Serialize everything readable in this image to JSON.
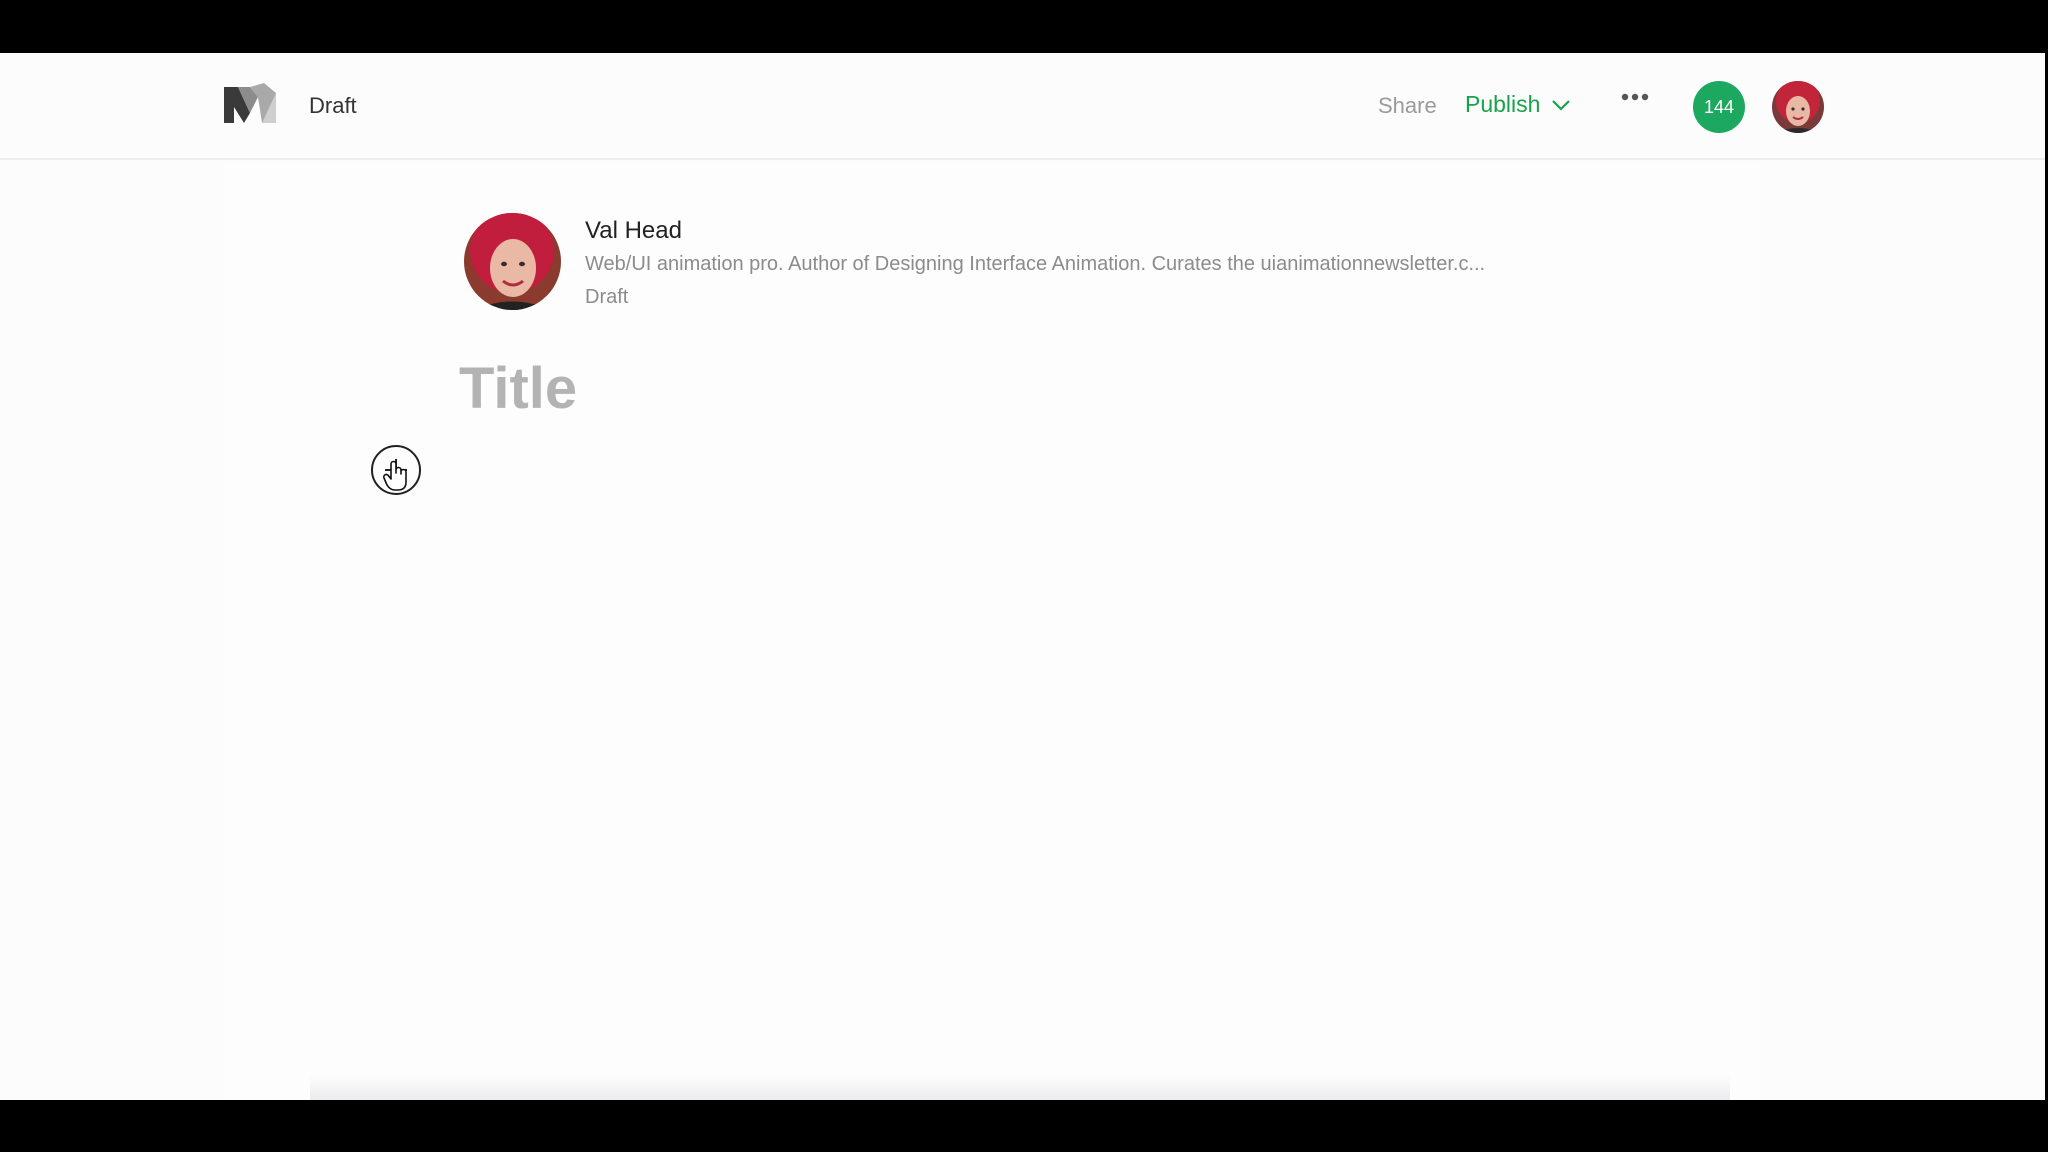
{
  "header": {
    "logo": "medium-logo-icon",
    "status": "Draft",
    "share_label": "Share",
    "publish_label": "Publish",
    "more_icon": "ellipsis-icon",
    "notifications_count": "144"
  },
  "author": {
    "name": "Val Head",
    "bio": "Web/UI animation pro. Author of Designing Interface Animation. Curates the uianimationnewsletter.c...",
    "post_status": "Draft"
  },
  "editor": {
    "title_placeholder": "Title",
    "add_button_icon": "plus-icon"
  },
  "colors": {
    "accent_green": "#1ca95f",
    "publish_text": "#17a34a",
    "muted_text": "#8b8b8b"
  }
}
